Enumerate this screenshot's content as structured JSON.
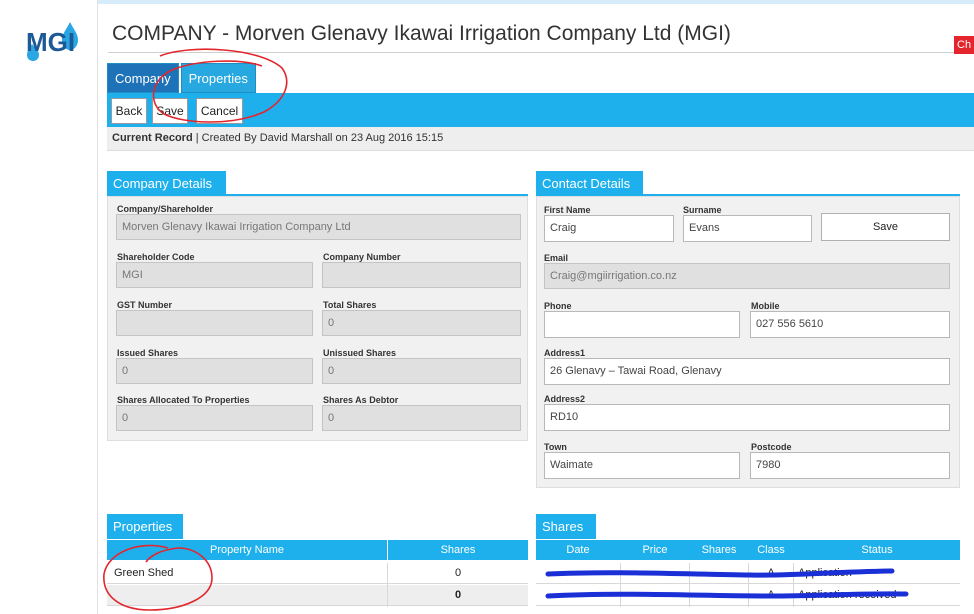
{
  "logo": {
    "text": "MGI"
  },
  "title": "COMPANY - Morven Glenavy Ikawai Irrigation Company Ltd (MGI)",
  "corner_tab": "Ch",
  "tabs": [
    {
      "label": "Company",
      "active": true
    },
    {
      "label": "Properties",
      "active": false
    }
  ],
  "toolbar": {
    "back": "Back",
    "save": "Save",
    "cancel": "Cancel"
  },
  "record": {
    "label": "Current Record",
    "detail": " | Created By David Marshall on 23 Aug 2016 15:15"
  },
  "company_details": {
    "heading": "Company Details",
    "fields": {
      "company_shareholder": {
        "label": "Company/Shareholder",
        "value": "Morven Glenavy Ikawai Irrigation Company Ltd"
      },
      "shareholder_code": {
        "label": "Shareholder Code",
        "value": "MGI"
      },
      "company_number": {
        "label": "Company Number",
        "value": ""
      },
      "gst_number": {
        "label": "GST Number",
        "value": ""
      },
      "total_shares": {
        "label": "Total Shares",
        "value": "0"
      },
      "issued_shares": {
        "label": "Issued Shares",
        "value": "0"
      },
      "unissued_shares": {
        "label": "Unissued Shares",
        "value": "0"
      },
      "shares_allocated": {
        "label": "Shares Allocated To Properties",
        "value": "0"
      },
      "shares_debtor": {
        "label": "Shares As Debtor",
        "value": "0"
      }
    }
  },
  "contact_details": {
    "heading": "Contact Details",
    "save": "Save",
    "fields": {
      "first_name": {
        "label": "First Name",
        "value": "Craig"
      },
      "surname": {
        "label": "Surname",
        "value": "Evans"
      },
      "email": {
        "label": "Email",
        "value": "Craig@mgiirrigation.co.nz"
      },
      "phone": {
        "label": "Phone",
        "value": ""
      },
      "mobile": {
        "label": "Mobile",
        "value": "027 556 5610"
      },
      "address1": {
        "label": "Address1",
        "value": "26 Glenavy – Tawai Road, Glenavy"
      },
      "address2": {
        "label": "Address2",
        "value": "RD10"
      },
      "town": {
        "label": "Town",
        "value": "Waimate"
      },
      "postcode": {
        "label": "Postcode",
        "value": "7980"
      }
    }
  },
  "properties": {
    "heading": "Properties",
    "columns": [
      "Property Name",
      "Shares"
    ],
    "rows": [
      {
        "name": "Green Shed",
        "shares": "0"
      }
    ],
    "total": "0"
  },
  "shares": {
    "heading": "Shares",
    "columns": [
      "Date",
      "Price",
      "Shares",
      "Class",
      "Status"
    ],
    "rows": [
      {
        "class": "A",
        "status": "Application"
      },
      {
        "class": "A",
        "status": "Application received"
      }
    ]
  },
  "colors": {
    "accent": "#1eb0ec",
    "tab_active": "#1e72b8",
    "annotation": "#e3262d",
    "redaction": "#1a2fd6"
  }
}
